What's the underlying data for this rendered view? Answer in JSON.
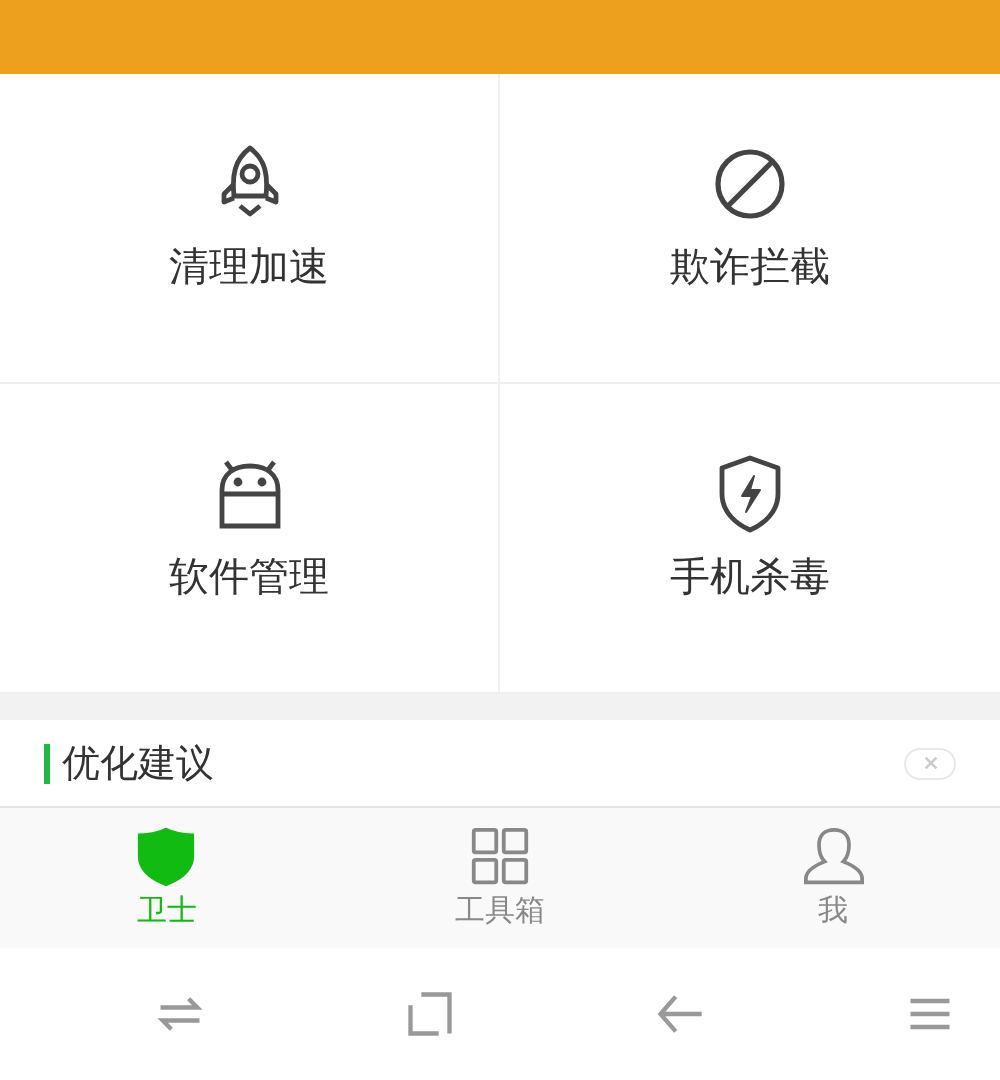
{
  "features": [
    {
      "label": "清理加速"
    },
    {
      "label": "欺诈拦截"
    },
    {
      "label": "软件管理"
    },
    {
      "label": "手机杀毒"
    }
  ],
  "suggestion": {
    "title": "优化建议"
  },
  "tabs": [
    {
      "label": "卫士",
      "selected": true
    },
    {
      "label": "工具箱",
      "selected": false
    },
    {
      "label": "我",
      "selected": false
    }
  ]
}
